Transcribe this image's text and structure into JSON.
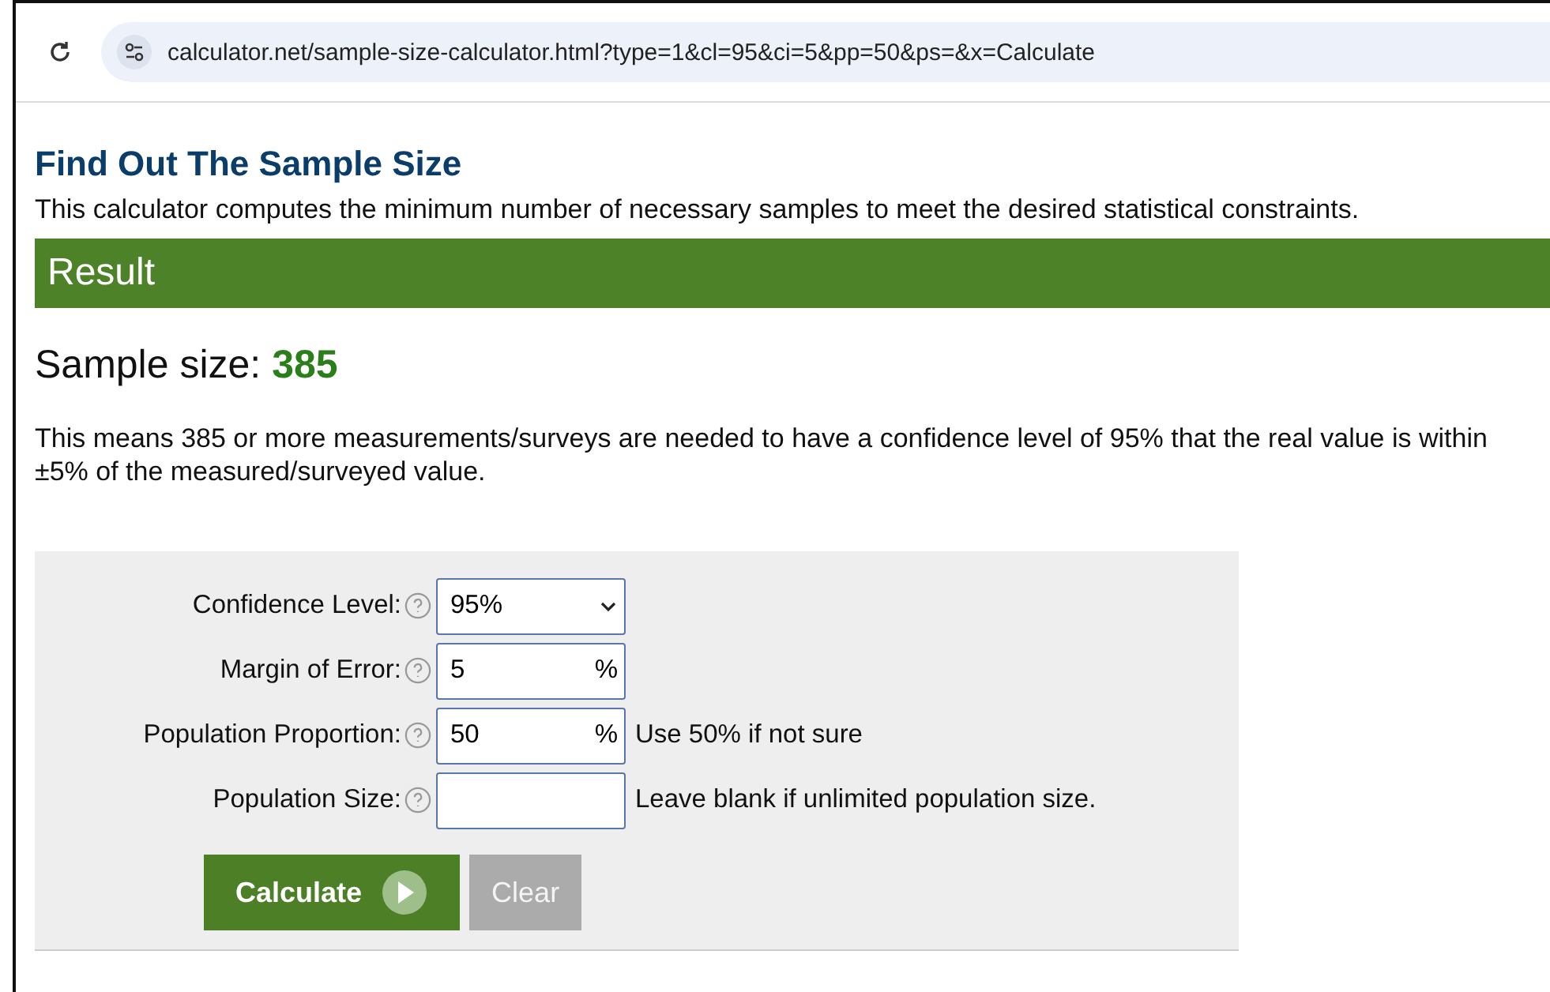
{
  "address_bar": {
    "url": "calculator.net/sample-size-calculator.html?type=1&cl=95&ci=5&pp=50&ps=&x=Calculate"
  },
  "heading": "Find Out The Sample Size",
  "intro": "This calculator computes the minimum number of necessary samples to meet the desired statistical constraints.",
  "result": {
    "title": "Result",
    "label": "Sample size:",
    "value": "385",
    "explanation": "This means 385 or more measurements/surveys are needed to have a confidence level of 95% that the real value is within ±5% of the measured/surveyed value."
  },
  "form": {
    "fields": [
      {
        "kind": "select",
        "label": "Confidence Level:",
        "value": "95%"
      },
      {
        "kind": "input",
        "label": "Margin of Error:",
        "value": "5",
        "suffix": "%"
      },
      {
        "kind": "input",
        "label": "Population Proportion:",
        "value": "50",
        "suffix": "%",
        "note": "Use 50% if not sure"
      },
      {
        "kind": "input",
        "label": "Population Size:",
        "note": "Leave blank if unlimited population size."
      }
    ],
    "buttons": [
      {
        "kind": "primary",
        "label": "Calculate"
      },
      {
        "kind": "secondary",
        "label": "Clear"
      }
    ]
  }
}
